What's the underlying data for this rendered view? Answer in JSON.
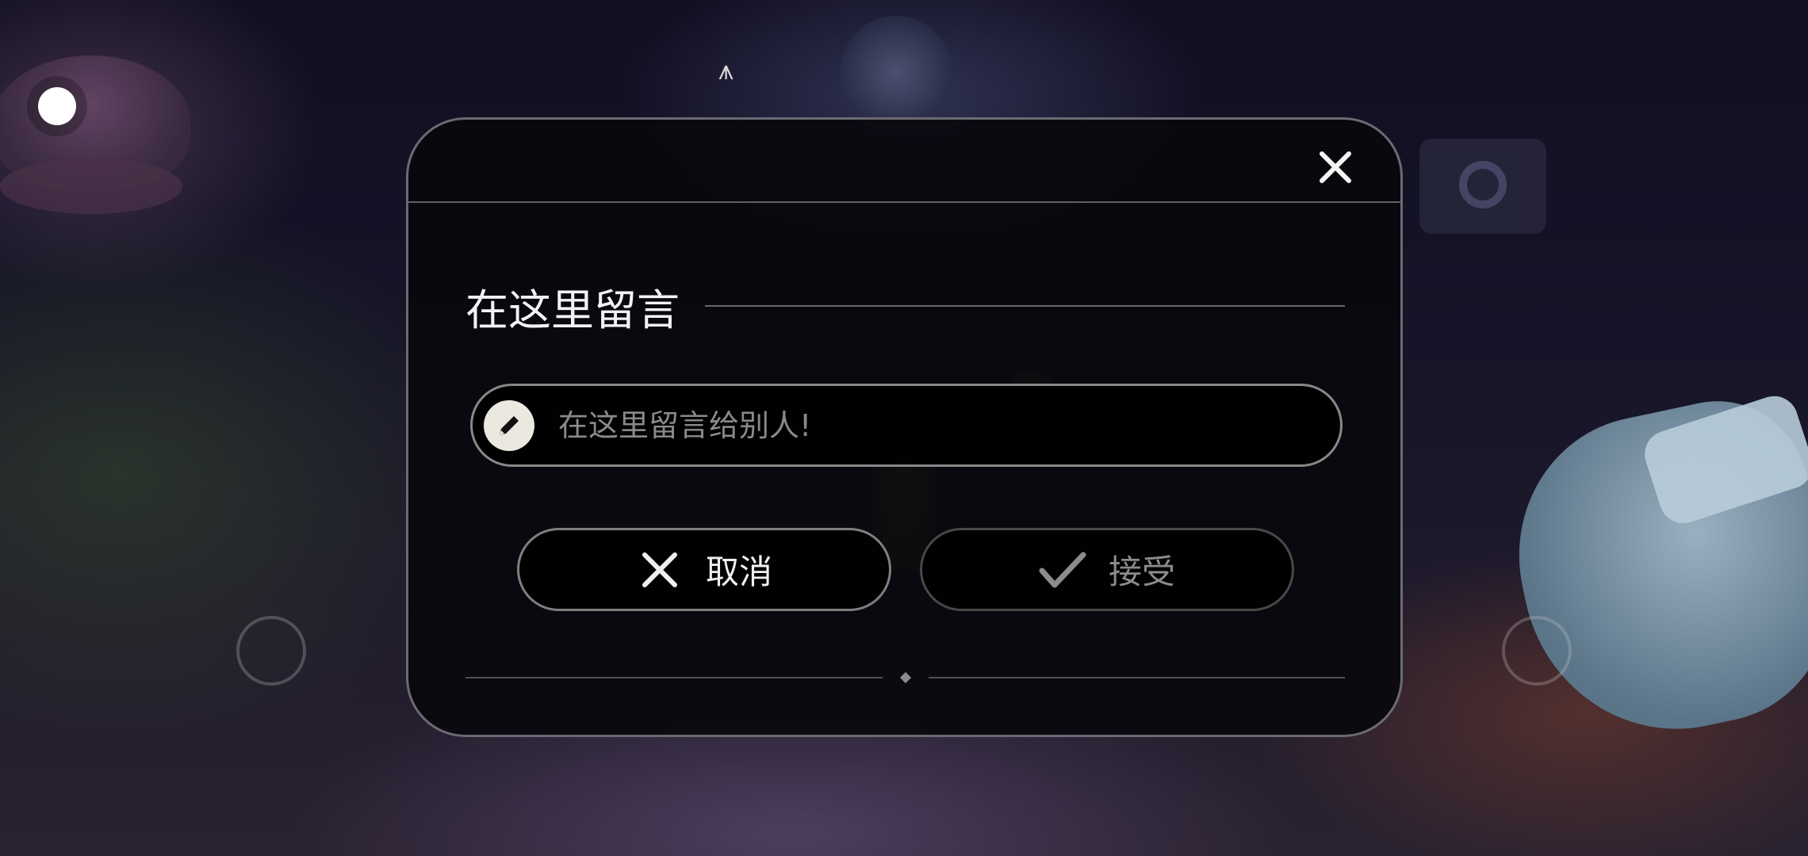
{
  "dialog": {
    "title": "在这里留言",
    "input": {
      "placeholder": "在这里留言给别人!",
      "value": ""
    },
    "buttons": {
      "cancel_label": "取消",
      "accept_label": "接受"
    },
    "close_icon": "close-icon"
  },
  "hud": {
    "icons": [
      "menu-dot-icon",
      "joystick-left",
      "joystick-right"
    ]
  },
  "colors": {
    "dialog_bg": "#08080c",
    "border": "#8c8c96",
    "text_primary": "#f2f2f2",
    "text_disabled": "#8c8c8c",
    "pencil_badge": "#ebe8df"
  }
}
